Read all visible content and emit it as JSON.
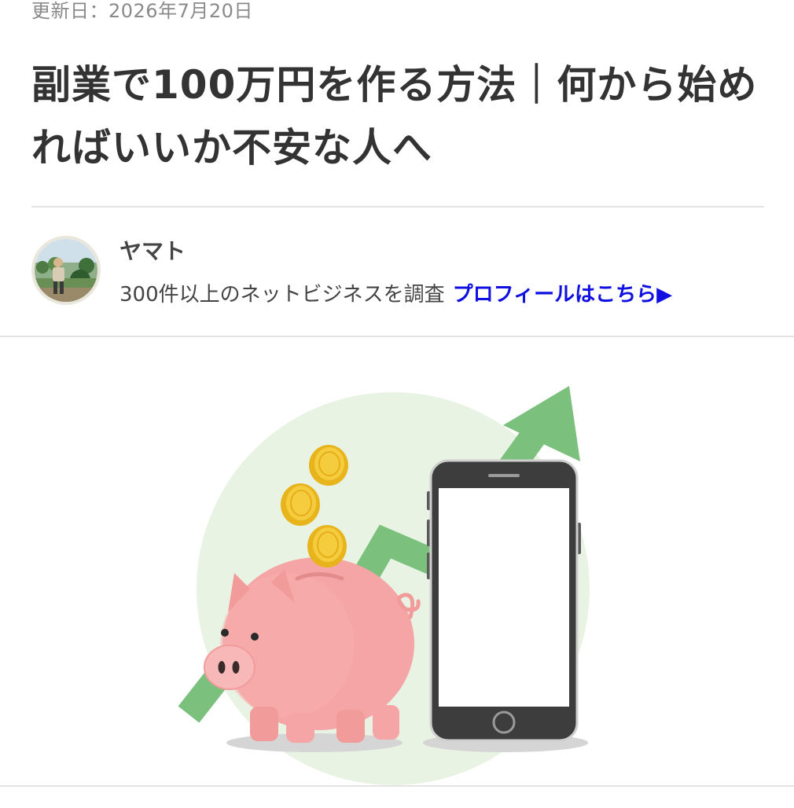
{
  "article": {
    "updated": "更新日：2026年7月20日",
    "title": "副業で100万円を作る方法｜何から始めればいいか不安な人へ"
  },
  "author": {
    "name": "ヤマト",
    "description": "300件以上のネットビジネスを調査",
    "profile_link": "プロフィールはこちら▶",
    "avatar_icon": "author-photo"
  },
  "hero": {
    "illustration": "piggy-bank-smartphone-growth-arrow",
    "colors": {
      "background_circle": "#e9f3e3",
      "arrow": "#7cc07d",
      "pig": "#f5a5a5",
      "coin": "#f2c331",
      "phone_body": "#3d3d3d",
      "link": "#1010e0"
    }
  }
}
